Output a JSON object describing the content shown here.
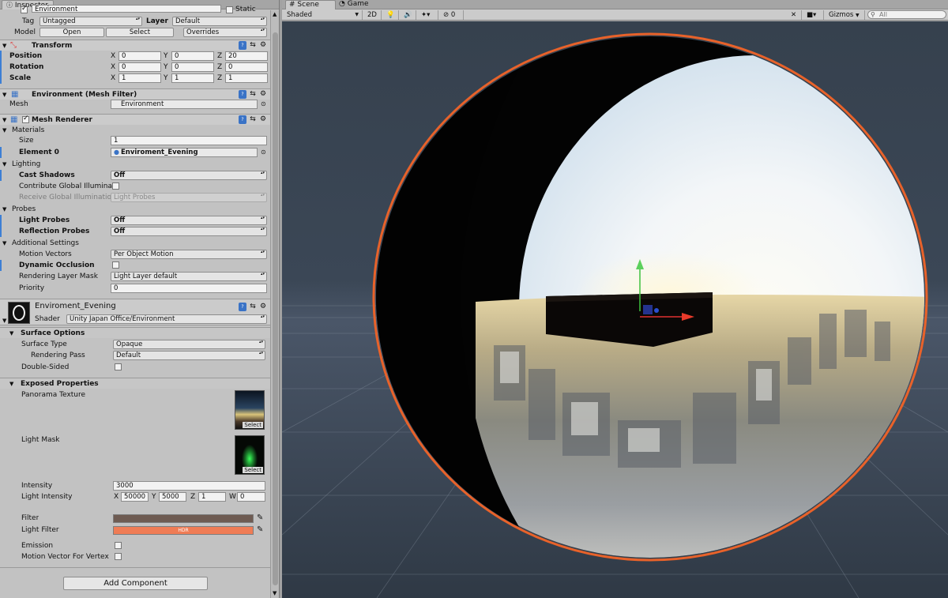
{
  "inspector": {
    "tab_label": "Inspector",
    "object_name": "Environment",
    "static_label": "Static",
    "tag_label": "Tag",
    "tag_value": "Untagged",
    "layer_label": "Layer",
    "layer_value": "Default",
    "model_label": "Model",
    "model_buttons": [
      "Open",
      "Select",
      "Overrides"
    ],
    "transform": {
      "title": "Transform",
      "position": {
        "label": "Position",
        "x": "0",
        "y": "0",
        "z": "20"
      },
      "rotation": {
        "label": "Rotation",
        "x": "0",
        "y": "0",
        "z": "0"
      },
      "scale": {
        "label": "Scale",
        "x": "1",
        "y": "1",
        "z": "1"
      }
    },
    "axis_labels": {
      "x": "X",
      "y": "Y",
      "z": "Z",
      "w": "W"
    },
    "mesh_filter": {
      "title": "Environment (Mesh Filter)",
      "mesh_label": "Mesh",
      "mesh_value": "Environment"
    },
    "mesh_renderer": {
      "title": "Mesh Renderer",
      "materials_label": "Materials",
      "size_label": "Size",
      "size_value": "1",
      "element0_label": "Element 0",
      "element0_value": "Enviroment_Evening",
      "lighting_label": "Lighting",
      "cast_shadows_label": "Cast Shadows",
      "cast_shadows_value": "Off",
      "contribute_gi_label": "Contribute Global Illumina",
      "receive_gi_label": "Receive Global Illuminatio",
      "receive_gi_value": "Light Probes",
      "probes_label": "Probes",
      "light_probes_label": "Light Probes",
      "light_probes_value": "Off",
      "reflection_probes_label": "Reflection Probes",
      "reflection_probes_value": "Off",
      "additional_label": "Additional Settings",
      "motion_vectors_label": "Motion Vectors",
      "motion_vectors_value": "Per Object Motion",
      "dynamic_occlusion_label": "Dynamic Occlusion",
      "rendering_layer_label": "Rendering Layer Mask",
      "rendering_layer_value": "Light Layer default",
      "priority_label": "Priority",
      "priority_value": "0"
    },
    "material": {
      "name": "Enviroment_Evening",
      "shader_label": "Shader",
      "shader_value": "Unity Japan Office/Environment",
      "surface_options_label": "Surface Options",
      "surface_type_label": "Surface Type",
      "surface_type_value": "Opaque",
      "rendering_pass_label": "Rendering Pass",
      "rendering_pass_value": "Default",
      "double_sided_label": "Double-Sided",
      "exposed_label": "Exposed Properties",
      "panorama_label": "Panorama Texture",
      "light_mask_label": "Light Mask",
      "select_label": "Select",
      "intensity_label": "Intensity",
      "intensity_value": "3000",
      "light_intensity_label": "Light Intensity",
      "light_intensity": {
        "x": "50000",
        "y": "5000",
        "z": "1",
        "w": "0"
      },
      "filter_label": "Filter",
      "filter_color": "#6e5b52",
      "light_filter_label": "Light Filter",
      "light_filter_color": "#ef7c55",
      "hdr_label": "HDR",
      "emission_label": "Emission",
      "motion_vertex_label": "Motion Vector For Vertex"
    },
    "add_component_label": "Add Component"
  },
  "scene": {
    "tabs": [
      "Scene",
      "Game"
    ],
    "toolbar": {
      "shading": "Shaded",
      "mode_2d": "2D",
      "counter": "0",
      "gizmos": "Gizmos",
      "search_placeholder": "All"
    }
  },
  "colors": {
    "accent_blue": "#3d7fd4",
    "selection_outline": "#e8622a",
    "viewport_bg": "#36414e"
  }
}
